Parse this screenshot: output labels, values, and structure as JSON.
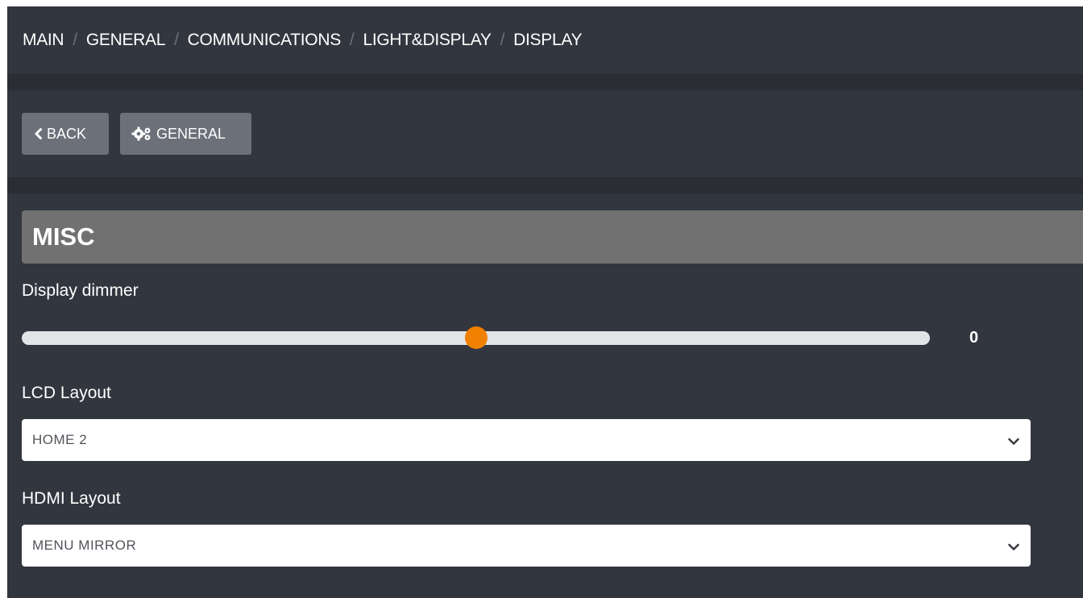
{
  "breadcrumb": {
    "items": [
      "MAIN",
      "GENERAL",
      "COMMUNICATIONS",
      "LIGHT&DISPLAY",
      "DISPLAY"
    ],
    "separator": "/"
  },
  "toolbar": {
    "back_label": "BACK",
    "general_label": "GENERAL",
    "back_icon": "chevron-left-icon",
    "general_icon": "gears-icon"
  },
  "section": {
    "title": "MISC"
  },
  "display_dimmer": {
    "label": "Display dimmer",
    "value": "0",
    "position_fraction": 0.5
  },
  "lcd_layout": {
    "label": "LCD Layout",
    "selected": "HOME 2"
  },
  "hdmi_layout": {
    "label": "HDMI Layout",
    "selected": "MENU MIRROR"
  },
  "colors": {
    "background": "#2a2d33",
    "panel": "#32363e",
    "button": "#6c7079",
    "section_header": "#717171",
    "slider_track": "#e3e4e7",
    "slider_thumb": "#f08000"
  }
}
